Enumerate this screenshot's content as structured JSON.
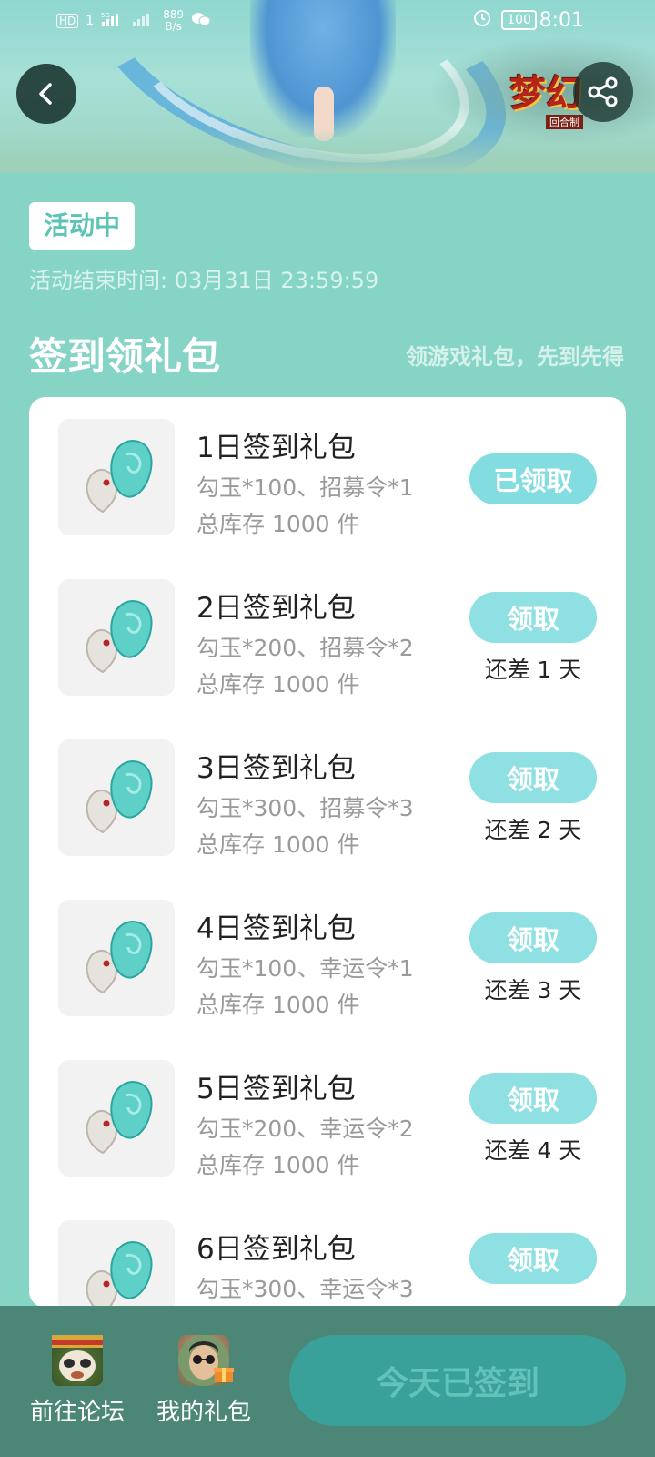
{
  "status_bar": {
    "network_left": "HD",
    "network_badge": "1",
    "signal_label": "5G",
    "speed_value": "889",
    "speed_unit": "B/s",
    "battery": "100",
    "time": "8:01"
  },
  "banner": {
    "logo_text": "梦幻",
    "logo_sub": "回合制"
  },
  "activity": {
    "status_tag": "活动中",
    "end_time": "活动结束时间: 03月31日 23:59:59"
  },
  "section": {
    "title": "签到领礼包",
    "subtitle": "领游戏礼包，先到先得"
  },
  "gifts": [
    {
      "title": "1日签到礼包",
      "desc": "勾玉*100、招募令*1",
      "stock": "总库存 1000 件",
      "button": "已领取",
      "remain": ""
    },
    {
      "title": "2日签到礼包",
      "desc": "勾玉*200、招募令*2",
      "stock": "总库存 1000 件",
      "button": "领取",
      "remain": "还差 1 天"
    },
    {
      "title": "3日签到礼包",
      "desc": "勾玉*300、招募令*3",
      "stock": "总库存 1000 件",
      "button": "领取",
      "remain": "还差 2 天"
    },
    {
      "title": "4日签到礼包",
      "desc": "勾玉*100、幸运令*1",
      "stock": "总库存 1000 件",
      "button": "领取",
      "remain": "还差 3 天"
    },
    {
      "title": "5日签到礼包",
      "desc": "勾玉*200、幸运令*2",
      "stock": "总库存 1000 件",
      "button": "领取",
      "remain": "还差 4 天"
    },
    {
      "title": "6日签到礼包",
      "desc": "勾玉*300、幸运令*3",
      "stock": "",
      "button": "领取",
      "remain": ""
    }
  ],
  "bottom": {
    "forum_label": "前往论坛",
    "gift_label": "我的礼包",
    "checkin_label": "今天已签到"
  },
  "colors": {
    "page_bg": "#86d4c6",
    "button": "#8ee0e2",
    "bottom_bar": "#4c8676",
    "checkin": "#3aa19a"
  }
}
